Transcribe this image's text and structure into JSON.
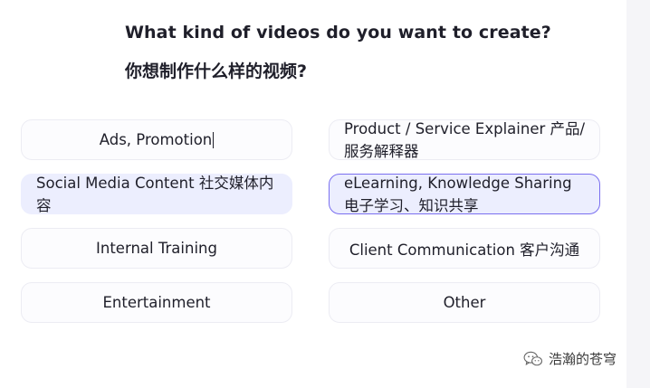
{
  "heading": {
    "english": "What kind of videos do you want to create?",
    "chinese": "你想制作什么样的视频?"
  },
  "options": [
    {
      "label": "Ads, Promotion",
      "state": "focused"
    },
    {
      "label": "Product / Service Explainer 产品/服务解释器",
      "state": "default"
    },
    {
      "label": "Social Media Content 社交媒体内容",
      "state": "selected"
    },
    {
      "label": "eLearning, Knowledge Sharing 电子学习、知识共享",
      "state": "active"
    },
    {
      "label": "Internal Training",
      "state": "default"
    },
    {
      "label": "Client Communication 客户沟通",
      "state": "default"
    },
    {
      "label": "Entertainment",
      "state": "default"
    },
    {
      "label": "Other",
      "state": "default"
    }
  ],
  "watermark": {
    "text": "浩瀚的苍穹",
    "icon": "wechat-icon"
  },
  "colors": {
    "accent_border": "#7a6ff0",
    "selected_fill": "#eceefe",
    "card_border": "#ececf3"
  }
}
